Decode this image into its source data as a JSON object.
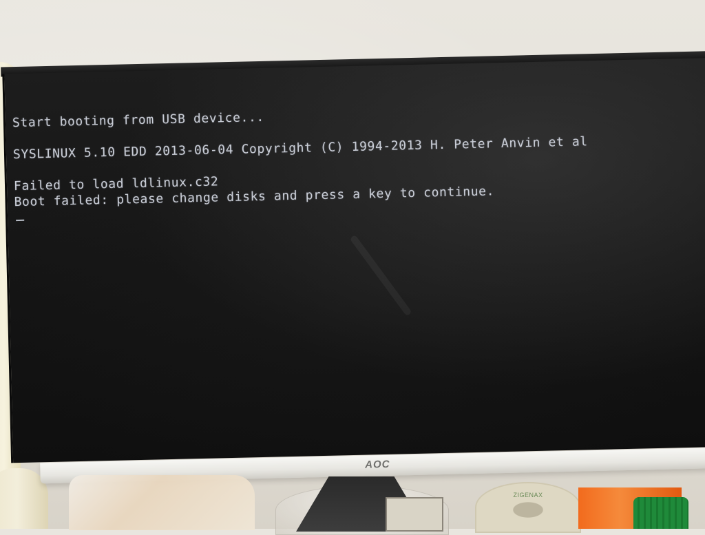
{
  "terminal": {
    "lines": [
      "Start booting from USB device...",
      "",
      "SYSLINUX 5.10 EDD 2013-06-04 Copyright (C) 1994-2013 H. Peter Anvin et al",
      "",
      "Failed to load ldlinux.c32",
      "Boot failed: please change disks and press a key to continue."
    ]
  },
  "monitor": {
    "brand": "AOC"
  },
  "props": {
    "tape_label": "ZIGENAX"
  },
  "colors": {
    "screen_text": "#c9cdd6",
    "screen_background": "#151515",
    "bezel": "#e7e6e1"
  }
}
